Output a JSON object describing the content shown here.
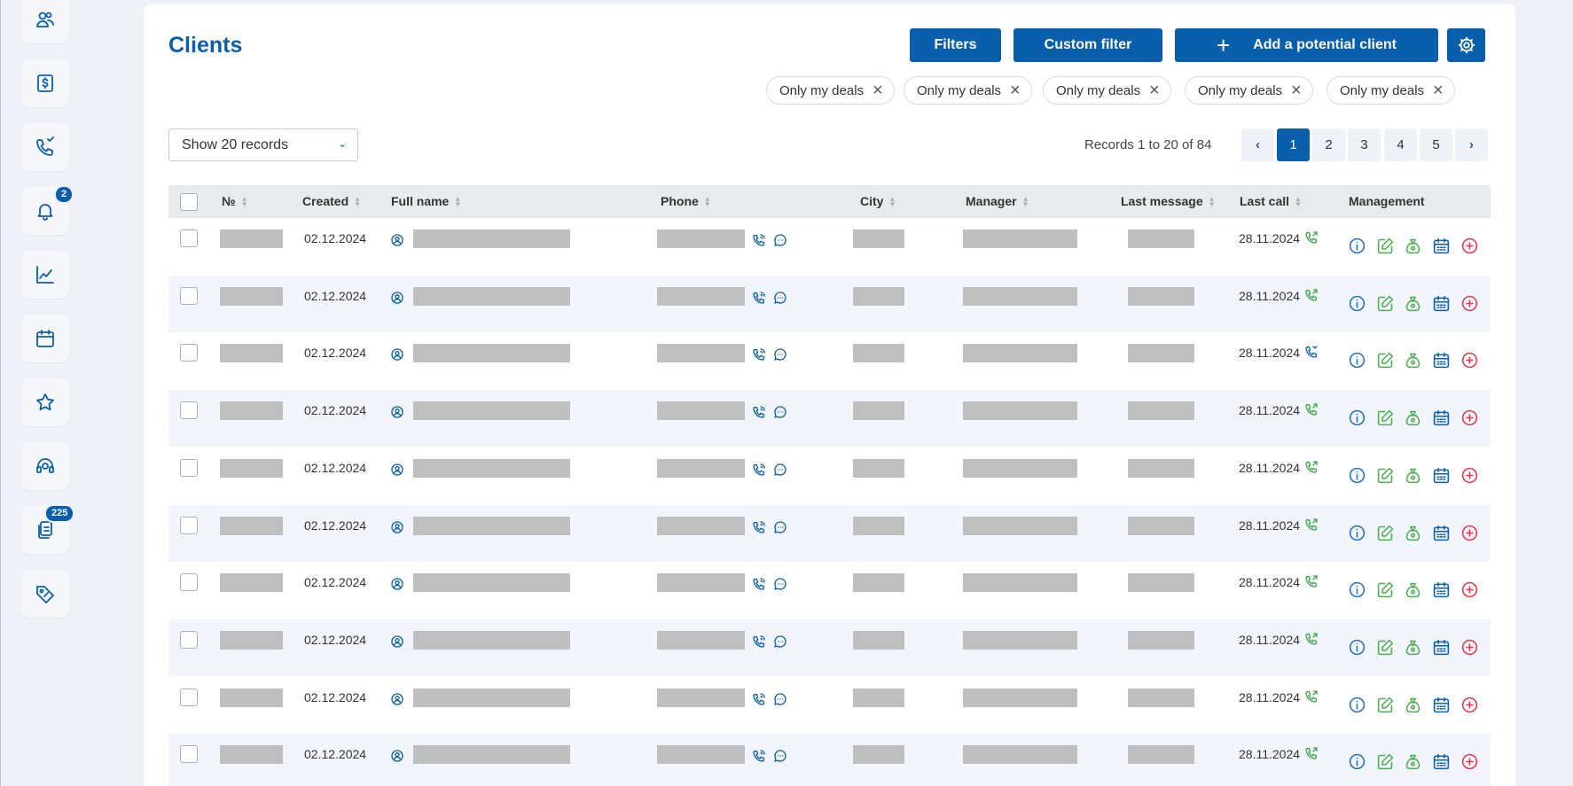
{
  "sidebar": {
    "items": [
      {
        "icon": "users-icon"
      },
      {
        "icon": "dollar-icon"
      },
      {
        "icon": "phone-call-icon"
      },
      {
        "icon": "bell-icon",
        "badge": "2"
      },
      {
        "icon": "chart-line-icon"
      },
      {
        "icon": "calendar-icon"
      },
      {
        "icon": "star-icon"
      },
      {
        "icon": "support-icon"
      },
      {
        "icon": "documents-icon",
        "badge": "225"
      },
      {
        "icon": "tag-icon"
      }
    ]
  },
  "header": {
    "title": "Clients",
    "filters_label": "Filters",
    "custom_filter_label": "Custom filter",
    "add_client_label": "Add a potential client",
    "add_client_plus": "+"
  },
  "chips": [
    "Only my deals",
    "Only my deals",
    "Only my deals",
    "Only my deals",
    "Only my deals"
  ],
  "chip_close": "×",
  "records_select": {
    "value": "Show 20 records"
  },
  "pagination": {
    "summary": "Records 1 to 20 of 84",
    "prev": "‹",
    "next": "›",
    "pages": [
      "1",
      "2",
      "3",
      "4",
      "5"
    ],
    "active_page": "1"
  },
  "table": {
    "columns": {
      "number": "№",
      "created": "Created",
      "full_name": "Full name",
      "phone": "Phone",
      "city": "City",
      "manager": "Manager",
      "last_message": "Last message",
      "last_call": "Last call",
      "management": "Management"
    },
    "rows": [
      {
        "created": "02.12.2024",
        "last_call": "28.11.2024",
        "call_type": "outgoing"
      },
      {
        "created": "02.12.2024",
        "last_call": "28.11.2024",
        "call_type": "outgoing"
      },
      {
        "created": "02.12.2024",
        "last_call": "28.11.2024",
        "call_type": "missed"
      },
      {
        "created": "02.12.2024",
        "last_call": "28.11.2024",
        "call_type": "outgoing"
      },
      {
        "created": "02.12.2024",
        "last_call": "28.11.2024",
        "call_type": "outgoing"
      },
      {
        "created": "02.12.2024",
        "last_call": "28.11.2024",
        "call_type": "outgoing"
      },
      {
        "created": "02.12.2024",
        "last_call": "28.11.2024",
        "call_type": "outgoing"
      },
      {
        "created": "02.12.2024",
        "last_call": "28.11.2024",
        "call_type": "outgoing"
      },
      {
        "created": "02.12.2024",
        "last_call": "28.11.2024",
        "call_type": "outgoing"
      },
      {
        "created": "02.12.2024",
        "last_call": "28.11.2024",
        "call_type": "outgoing"
      }
    ]
  },
  "colors": {
    "accent": "#0a5fad",
    "call_outgoing": "#3aa845",
    "call_missed": "#0a5fad",
    "info": "#1e73c8",
    "edit": "#4caf50",
    "deal": "#4caf50",
    "calendar": "#0a5fad",
    "delete": "#e53950",
    "redacted": "#bfbfbf"
  }
}
